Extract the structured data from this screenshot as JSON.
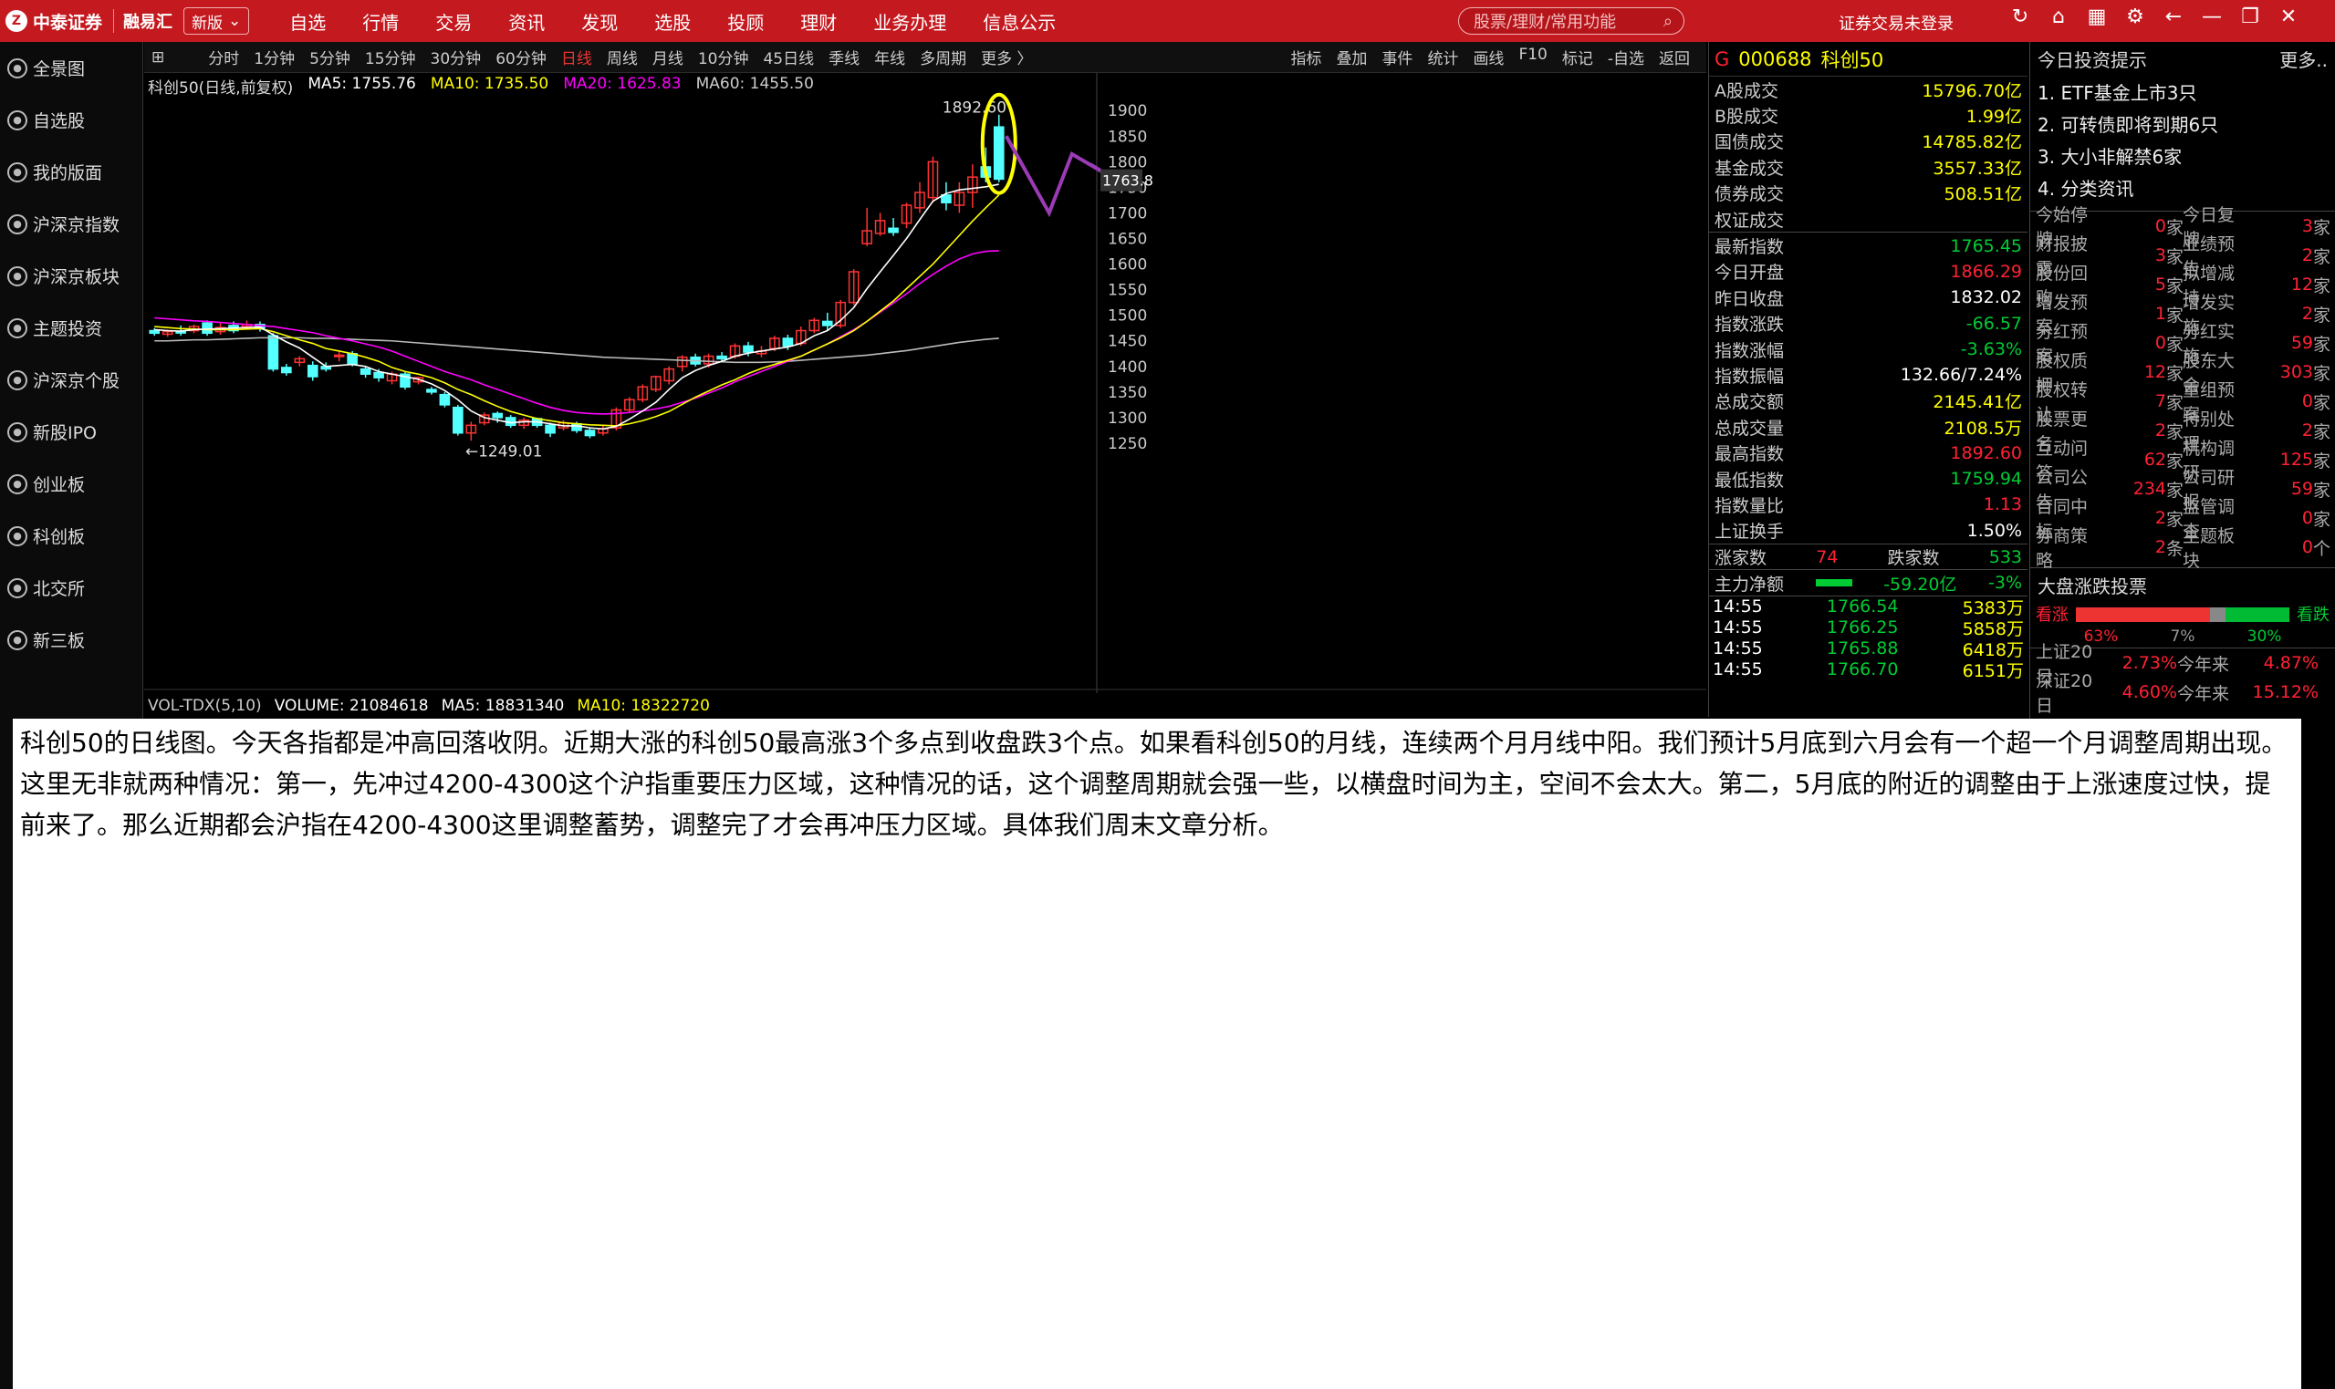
{
  "app": {
    "logo": "中泰证券",
    "sub": "融易汇",
    "version": "新版"
  },
  "menu": [
    "自选",
    "行情",
    "交易",
    "资讯",
    "发现",
    "选股",
    "投顾",
    "理财",
    "业务办理",
    "信息公示"
  ],
  "search": {
    "placeholder": "股票/理财/常用功能"
  },
  "login": "证券交易未登录",
  "sidebar": [
    "全景图",
    "自选股",
    "我的版面",
    "沪深京指数",
    "沪深京板块",
    "主题投资",
    "沪深京个股",
    "新股IPO",
    "创业板",
    "科创板",
    "北交所",
    "新三板"
  ],
  "toolbar": {
    "periods": [
      "分时",
      "1分钟",
      "5分钟",
      "15分钟",
      "30分钟",
      "60分钟",
      "日线",
      "周线",
      "月线",
      "10分钟",
      "45日线",
      "季线",
      "年线",
      "多周期",
      "更多 〉"
    ],
    "active": "日线",
    "tools": [
      "指标",
      "叠加",
      "事件",
      "统计",
      "画线",
      "F10",
      "标记",
      "-自选",
      "返回"
    ]
  },
  "chart_info": {
    "title": "科创50(日线,前复权)",
    "ma5": "MA5: 1755.76",
    "ma10": "MA10: 1735.50",
    "ma20": "MA20: 1625.83",
    "ma60": "MA60: 1455.50",
    "vol": "VOL-TDX(5,10)",
    "volume": "VOLUME: 21084618",
    "vma5": "MA5: 18831340",
    "vma10": "MA10: 18322720",
    "hi_label": "1892.60",
    "lo_label": "←1249.01",
    "cursor_price": "1763.8"
  },
  "chart_data": {
    "type": "candlestick",
    "ylim": [
      1225,
      1920
    ],
    "yticks": [
      1900,
      1850,
      1800,
      1750,
      1700,
      1650,
      1600,
      1550,
      1500,
      1450,
      1400,
      1350,
      1300,
      1250
    ],
    "candles": [
      [
        1470,
        1465,
        1475,
        1460
      ],
      [
        1463,
        1468,
        1472,
        1458
      ],
      [
        1468,
        1466,
        1480,
        1460
      ],
      [
        1470,
        1478,
        1482,
        1465
      ],
      [
        1485,
        1465,
        1490,
        1460
      ],
      [
        1468,
        1476,
        1485,
        1462
      ],
      [
        1480,
        1470,
        1488,
        1465
      ],
      [
        1478,
        1482,
        1490,
        1472
      ],
      [
        1482,
        1475,
        1488,
        1468
      ],
      [
        1460,
        1395,
        1465,
        1390
      ],
      [
        1398,
        1388,
        1405,
        1382
      ],
      [
        1408,
        1415,
        1420,
        1400
      ],
      [
        1402,
        1380,
        1410,
        1372
      ],
      [
        1400,
        1395,
        1408,
        1390
      ],
      [
        1420,
        1422,
        1428,
        1410
      ],
      [
        1425,
        1405,
        1430,
        1400
      ],
      [
        1395,
        1385,
        1400,
        1378
      ],
      [
        1388,
        1378,
        1395,
        1370
      ],
      [
        1372,
        1385,
        1390,
        1365
      ],
      [
        1385,
        1360,
        1390,
        1355
      ],
      [
        1370,
        1378,
        1380,
        1365
      ],
      [
        1355,
        1350,
        1360,
        1345
      ],
      [
        1345,
        1325,
        1350,
        1320
      ],
      [
        1320,
        1270,
        1325,
        1265
      ],
      [
        1270,
        1285,
        1292,
        1255
      ],
      [
        1290,
        1305,
        1310,
        1285
      ],
      [
        1308,
        1300,
        1312,
        1290
      ],
      [
        1300,
        1285,
        1305,
        1280
      ],
      [
        1285,
        1295,
        1300,
        1278
      ],
      [
        1298,
        1285,
        1300,
        1280
      ],
      [
        1285,
        1270,
        1290,
        1262
      ],
      [
        1280,
        1290,
        1295,
        1275
      ],
      [
        1288,
        1275,
        1292,
        1270
      ],
      [
        1275,
        1265,
        1280,
        1260
      ],
      [
        1270,
        1278,
        1285,
        1265
      ],
      [
        1280,
        1315,
        1320,
        1275
      ],
      [
        1315,
        1335,
        1340,
        1310
      ],
      [
        1335,
        1360,
        1365,
        1330
      ],
      [
        1355,
        1380,
        1382,
        1350
      ],
      [
        1372,
        1395,
        1400,
        1365
      ],
      [
        1400,
        1418,
        1422,
        1390
      ],
      [
        1418,
        1405,
        1425,
        1400
      ],
      [
        1405,
        1420,
        1425,
        1398
      ],
      [
        1420,
        1415,
        1428,
        1408
      ],
      [
        1420,
        1440,
        1445,
        1415
      ],
      [
        1440,
        1428,
        1448,
        1420
      ],
      [
        1425,
        1430,
        1440,
        1418
      ],
      [
        1435,
        1455,
        1460,
        1430
      ],
      [
        1455,
        1440,
        1462,
        1432
      ],
      [
        1445,
        1470,
        1478,
        1440
      ],
      [
        1470,
        1490,
        1495,
        1465
      ],
      [
        1488,
        1480,
        1505,
        1470
      ],
      [
        1480,
        1525,
        1530,
        1475
      ],
      [
        1525,
        1585,
        1590,
        1520
      ],
      [
        1640,
        1665,
        1710,
        1635
      ],
      [
        1660,
        1685,
        1700,
        1655
      ],
      [
        1670,
        1662,
        1690,
        1655
      ],
      [
        1680,
        1715,
        1720,
        1670
      ],
      [
        1710,
        1740,
        1760,
        1700
      ],
      [
        1730,
        1800,
        1810,
        1720
      ],
      [
        1735,
        1720,
        1760,
        1705
      ],
      [
        1715,
        1740,
        1760,
        1700
      ],
      [
        1740,
        1770,
        1795,
        1710
      ],
      [
        1790,
        1770,
        1828,
        1760
      ],
      [
        1868,
        1766,
        1892,
        1760
      ]
    ],
    "ma5": [
      1472,
      1470,
      1469,
      1472,
      1473,
      1474,
      1475,
      1476,
      1477,
      1462,
      1448,
      1436,
      1418,
      1400,
      1402,
      1404,
      1400,
      1390,
      1385,
      1380,
      1375,
      1366,
      1353,
      1335,
      1313,
      1300,
      1295,
      1290,
      1292,
      1292,
      1288,
      1284,
      1284,
      1280,
      1278,
      1283,
      1297,
      1313,
      1330,
      1355,
      1378,
      1392,
      1402,
      1410,
      1420,
      1426,
      1430,
      1434,
      1438,
      1445,
      1460,
      1470,
      1490,
      1515,
      1552,
      1585,
      1617,
      1650,
      1687,
      1723,
      1738,
      1745,
      1748,
      1751,
      1756
    ],
    "ma10": [
      1478,
      1476,
      1474,
      1473,
      1472,
      1472,
      1472,
      1473,
      1474,
      1468,
      1460,
      1452,
      1445,
      1435,
      1430,
      1425,
      1418,
      1410,
      1398,
      1390,
      1385,
      1378,
      1368,
      1355,
      1345,
      1333,
      1322,
      1312,
      1305,
      1298,
      1294,
      1290,
      1288,
      1286,
      1285,
      1284,
      1288,
      1294,
      1302,
      1312,
      1326,
      1340,
      1352,
      1364,
      1374,
      1386,
      1396,
      1404,
      1412,
      1420,
      1432,
      1444,
      1456,
      1470,
      1488,
      1508,
      1528,
      1552,
      1576,
      1600,
      1628,
      1656,
      1684,
      1710,
      1735
    ],
    "ma20": [
      1495,
      1493,
      1491,
      1489,
      1488,
      1486,
      1484,
      1482,
      1480,
      1478,
      1474,
      1470,
      1466,
      1460,
      1455,
      1450,
      1444,
      1438,
      1430,
      1420,
      1410,
      1400,
      1390,
      1382,
      1374,
      1364,
      1355,
      1346,
      1337,
      1328,
      1320,
      1314,
      1310,
      1308,
      1307,
      1308,
      1310,
      1313,
      1317,
      1322,
      1330,
      1338,
      1348,
      1358,
      1370,
      1380,
      1390,
      1400,
      1410,
      1420,
      1432,
      1444,
      1458,
      1472,
      1488,
      1506,
      1524,
      1542,
      1562,
      1580,
      1596,
      1610,
      1620,
      1625,
      1626
    ],
    "ma60": [
      1450,
      1450,
      1451,
      1452,
      1452,
      1453,
      1454,
      1455,
      1456,
      1456,
      1456,
      1456,
      1455,
      1455,
      1454,
      1453,
      1452,
      1451,
      1450,
      1448,
      1446,
      1444,
      1442,
      1440,
      1438,
      1436,
      1434,
      1432,
      1430,
      1428,
      1426,
      1424,
      1422,
      1420,
      1418,
      1417,
      1416,
      1415,
      1414,
      1413,
      1412,
      1411,
      1410,
      1409,
      1408,
      1408,
      1408,
      1409,
      1410,
      1412,
      1414,
      1416,
      1418,
      1420,
      1422,
      1425,
      1428,
      1431,
      1435,
      1439,
      1443,
      1447,
      1450,
      1453,
      1455
    ]
  },
  "quote": {
    "code": "000688",
    "name": "科创50",
    "flag": "G",
    "market": [
      {
        "label": "A股成交",
        "value": "15796.70亿"
      },
      {
        "label": "B股成交",
        "value": "1.99亿"
      },
      {
        "label": "国债成交",
        "value": "14785.82亿"
      },
      {
        "label": "基金成交",
        "value": "3557.33亿"
      },
      {
        "label": "债券成交",
        "value": "508.51亿"
      },
      {
        "label": "权证成交",
        "value": ""
      }
    ],
    "stats": [
      {
        "label": "最新指数",
        "value": "1765.45",
        "color": "green"
      },
      {
        "label": "今日开盘",
        "value": "1866.29",
        "color": "red"
      },
      {
        "label": "昨日收盘",
        "value": "1832.02",
        "color": "white"
      },
      {
        "label": "指数涨跌",
        "value": "-66.57",
        "color": "green"
      },
      {
        "label": "指数涨幅",
        "value": "-3.63%",
        "color": "green"
      },
      {
        "label": "指数振幅",
        "value": "132.66/7.24%",
        "color": "white"
      },
      {
        "label": "总成交额",
        "value": "2145.41亿",
        "color": "yellow"
      },
      {
        "label": "总成交量",
        "value": "2108.5万",
        "color": "yellow"
      },
      {
        "label": "最高指数",
        "value": "1892.60",
        "color": "red"
      },
      {
        "label": "最低指数",
        "value": "1759.94",
        "color": "green"
      },
      {
        "label": "指数量比",
        "value": "1.13",
        "color": "red"
      },
      {
        "label": "上证换手",
        "value": "1.50%",
        "color": "white"
      }
    ],
    "up_label": "涨家数",
    "up": "74",
    "down_label": "跌家数",
    "down": "533",
    "flow_label": "主力净额",
    "flow": "-59.20亿",
    "flow_pct": "-3%",
    "ticks": [
      {
        "t": "14:55",
        "p": "1766.54",
        "v": "5383万"
      },
      {
        "t": "14:55",
        "p": "1766.25",
        "v": "5858万"
      },
      {
        "t": "14:55",
        "p": "1765.88",
        "v": "6418万"
      },
      {
        "t": "14:55",
        "p": "1766.70",
        "v": "6151万"
      }
    ]
  },
  "right": {
    "title": "今日投资提示",
    "more": "更多..",
    "items": [
      "1. ETF基金上市3只",
      "2. 可转债即将到期6只",
      "3. 大小非解禁6家",
      "4. 分类资讯"
    ],
    "grid": [
      [
        "今始停牌",
        "0",
        "家",
        "今日复牌",
        "3",
        "家"
      ],
      [
        "财报披露",
        "3",
        "家",
        "业绩预告",
        "2",
        "家"
      ],
      [
        "股份回购",
        "5",
        "家",
        "拟增减持",
        "12",
        "家"
      ],
      [
        "增发预案",
        "1",
        "家",
        "增发实施",
        "2",
        "家"
      ],
      [
        "分红预案",
        "0",
        "家",
        "分红实施",
        "59",
        "家"
      ],
      [
        "股权质押",
        "12",
        "家",
        "股东大会",
        "303",
        "家"
      ],
      [
        "股权转让",
        "7",
        "家",
        "重组预案",
        "0",
        "家"
      ],
      [
        "股票更名",
        "2",
        "家",
        "特别处理",
        "2",
        "家"
      ],
      [
        "互动问答",
        "62",
        "家",
        "机构调研",
        "125",
        "家"
      ],
      [
        "公司公告",
        "234",
        "家",
        "公司研报",
        "59",
        "家"
      ],
      [
        "合同中标",
        "2",
        "家",
        "监管调查",
        "0",
        "家"
      ],
      [
        "券商策略",
        "2",
        "条",
        "主题板块",
        "0",
        "个"
      ]
    ],
    "vote_title": "大盘涨跌投票",
    "bull": "看涨",
    "bear": "看跌",
    "bull_pct": "63%",
    "mid_pct": "7%",
    "bear_pct": "30%",
    "idx": [
      {
        "a": "上证20日",
        "av": "2.73%",
        "b": "今年来",
        "bv": "4.87%"
      },
      {
        "a": "深证20日",
        "av": "4.60%",
        "b": "今年来",
        "bv": "15.12%"
      }
    ]
  },
  "note": "科创50的日线图。今天各指都是冲高回落收阴。近期大涨的科创50最高涨3个多点到收盘跌3个点。如果看科创50的月线，连续两个月月线中阳。我们预计5月底到六月会有一个超一个月调整周期出现。这里无非就两种情况：第一，先冲过4200-4300这个沪指重要压力区域，这种情况的话，这个调整周期就会强一些，以横盘时间为主，空间不会太大。第二，5月底的附近的调整由于上涨速度过快，提前来了。那么近期都会沪指在4200-4300这里调整蓄势，调整完了才会再冲压力区域。具体我们周末文章分析。",
  "colors": {
    "brand": "#c4191f",
    "up": "#ff3333",
    "down": "#54ffff",
    "ma5": "#ffffff",
    "ma10": "#ffff00",
    "ma20": "#ff00ff",
    "ma60": "#bbbbbb",
    "annot": "#9b3bb5",
    "circle": "#ffff00"
  }
}
